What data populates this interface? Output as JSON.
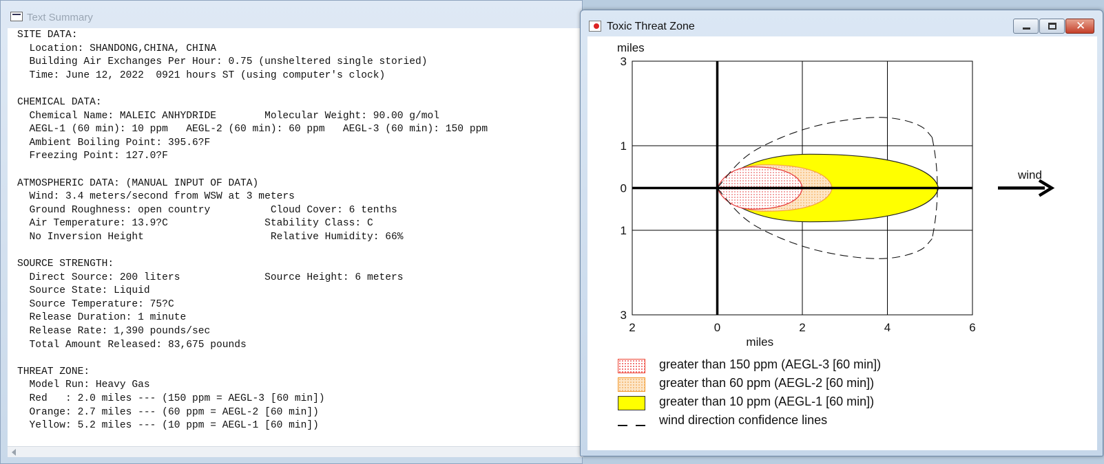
{
  "text_window": {
    "title": "Text Summary",
    "lines": [
      "SITE DATA:",
      "  Location: SHANDONG,CHINA, CHINA",
      "  Building Air Exchanges Per Hour: 0.75 (unsheltered single storied)",
      "  Time: June 12, 2022  0921 hours ST (using computer's clock)",
      "",
      "CHEMICAL DATA:",
      "  Chemical Name: MALEIC ANHYDRIDE        Molecular Weight: 90.00 g/mol",
      "  AEGL-1 (60 min): 10 ppm   AEGL-2 (60 min): 60 ppm   AEGL-3 (60 min): 150 ppm",
      "  Ambient Boiling Point: 395.6?F",
      "  Freezing Point: 127.0?F",
      "",
      "ATMOSPHERIC DATA: (MANUAL INPUT OF DATA)",
      "  Wind: 3.4 meters/second from WSW at 3 meters",
      "  Ground Roughness: open country          Cloud Cover: 6 tenths",
      "  Air Temperature: 13.9?C                Stability Class: C",
      "  No Inversion Height                     Relative Humidity: 66%",
      "",
      "SOURCE STRENGTH:",
      "  Direct Source: 200 liters              Source Height: 6 meters",
      "  Source State: Liquid",
      "  Source Temperature: 75?C",
      "  Release Duration: 1 minute",
      "  Release Rate: 1,390 pounds/sec",
      "  Total Amount Released: 83,675 pounds",
      "",
      "THREAT ZONE:",
      "  Model Run: Heavy Gas",
      "  Red   : 2.0 miles --- (150 ppm = AEGL-3 [60 min])",
      "  Orange: 2.7 miles --- (60 ppm = AEGL-2 [60 min])",
      "  Yellow: 5.2 miles --- (10 ppm = AEGL-1 [60 min])"
    ]
  },
  "zone_window": {
    "title": "Toxic Threat Zone",
    "buttons": {
      "minimize": "minimize",
      "maximize": "maximize",
      "close": "✕"
    },
    "wind_label": "wind",
    "legend": [
      {
        "key": "red",
        "label": "greater than 150 ppm (AEGL-3 [60 min])"
      },
      {
        "key": "orange",
        "label": "greater than 60 ppm (AEGL-2 [60 min])"
      },
      {
        "key": "yellow",
        "label": "greater than 10 ppm (AEGL-1 [60 min])"
      },
      {
        "key": "dash",
        "label": "wind direction confidence lines"
      }
    ]
  },
  "chart_data": {
    "type": "area",
    "xlabel": "miles",
    "ylabel": "miles",
    "xlim": [
      -2,
      6
    ],
    "ylim": [
      -3,
      3
    ],
    "x_ticks": [
      {
        "value": -2,
        "label": "2"
      },
      {
        "value": 0,
        "label": "0"
      },
      {
        "value": 2,
        "label": "2"
      },
      {
        "value": 4,
        "label": "4"
      },
      {
        "value": 6,
        "label": "6"
      }
    ],
    "y_ticks": [
      {
        "value": 3,
        "label": "3"
      },
      {
        "value": 1,
        "label": "1"
      },
      {
        "value": 0,
        "label": "0"
      },
      {
        "value": -1,
        "label": "1"
      },
      {
        "value": -3,
        "label": "3"
      }
    ],
    "grid": true,
    "legend_position": "bottom",
    "colors": {
      "red_zone": "#e53a3a",
      "orange_zone": "#f5a040",
      "yellow_zone": "#ffff00",
      "orange_fill": "#fde6c8"
    },
    "zones": [
      {
        "name": "yellow",
        "threshold_ppm": 10,
        "max_distance": 5.2,
        "half_width": 0.8
      },
      {
        "name": "orange",
        "threshold_ppm": 60,
        "max_distance": 2.7,
        "half_width": 0.55
      },
      {
        "name": "red",
        "threshold_ppm": 150,
        "max_distance": 2.0,
        "half_width": 0.5
      }
    ],
    "confidence_lines": {
      "max_distance": 5.3,
      "upper": [
        [
          0,
          0
        ],
        [
          0.5,
          0.62
        ],
        [
          1,
          0.98
        ],
        [
          2,
          1.4
        ],
        [
          3,
          1.62
        ],
        [
          4,
          1.7
        ],
        [
          4.8,
          1.5
        ],
        [
          5.05,
          1.2
        ]
      ],
      "lower": [
        [
          0,
          0
        ],
        [
          0.5,
          -0.62
        ],
        [
          1,
          -0.98
        ],
        [
          2,
          -1.4
        ],
        [
          3,
          -1.62
        ],
        [
          4,
          -1.7
        ],
        [
          4.8,
          -1.5
        ],
        [
          5.05,
          -1.2
        ]
      ]
    }
  }
}
